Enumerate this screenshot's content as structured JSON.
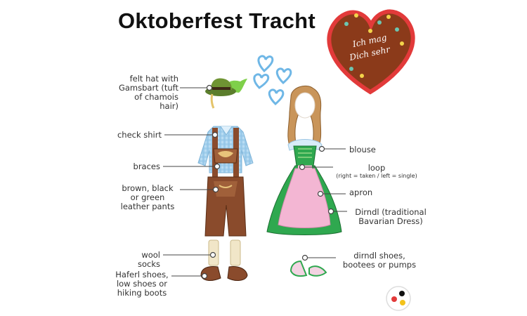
{
  "title": "Oktoberfest Tracht",
  "heart_text": [
    "Ich mag",
    "Dich sehr"
  ],
  "labels": {
    "hat": [
      "felt hat with",
      "Gamsbart (tuft",
      "of chamois hair)"
    ],
    "shirt": "check shirt",
    "braces": "braces",
    "pants": [
      "brown, black",
      "or green",
      "leather pants"
    ],
    "socks": "wool socks",
    "shoes_m": [
      "Haferl shoes,",
      "low shoes or",
      "hiking boots"
    ],
    "blouse": "blouse",
    "loop": "loop",
    "loop_note": "(right = taken / left = single)",
    "apron": "apron",
    "dirndl": [
      "Dirndl (traditional",
      "Bavarian Dress)"
    ],
    "shoes_w": [
      "dirndl shoes,",
      "bootees or pumps"
    ]
  },
  "colors": {
    "leather": "#8a4b2c",
    "shirt": "#a9d3ef",
    "dirndl_green": "#2fa84f",
    "apron_pink": "#f3b6d3",
    "heart_brown": "#8b3a1a",
    "heart_icing": "#e23a3a",
    "hearts_blue": "#6fb7e6"
  },
  "icons": [
    "hat-icon",
    "gingerbread-heart-icon",
    "blue-hearts-icon",
    "logo-icon"
  ]
}
